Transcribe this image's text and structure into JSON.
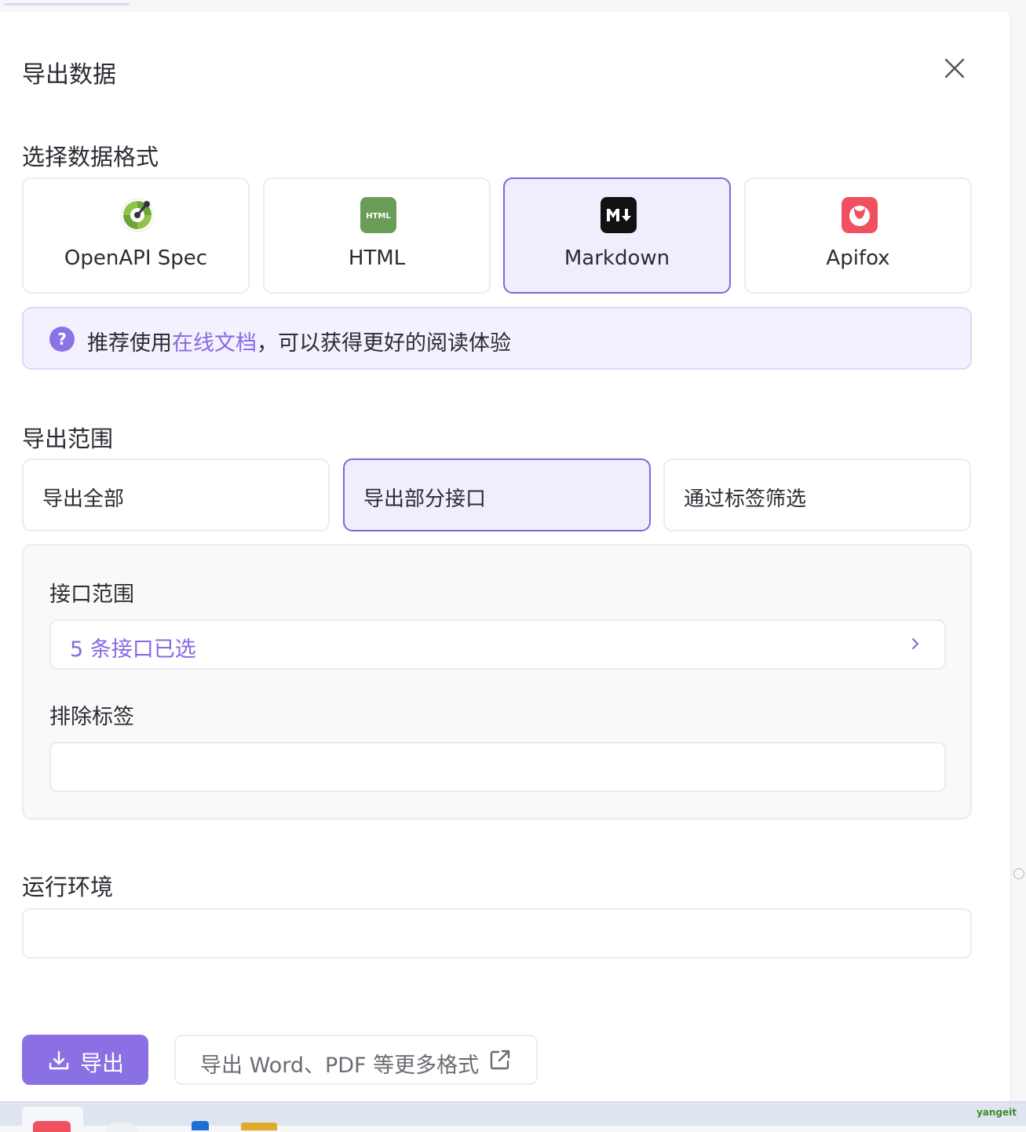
{
  "dialog": {
    "title": "导出数据"
  },
  "format_section": {
    "label": "选择数据格式",
    "options": [
      {
        "label": "OpenAPI Spec",
        "icon": "openapi-icon",
        "selected": false
      },
      {
        "label": "HTML",
        "icon": "html-icon",
        "selected": false
      },
      {
        "label": "Markdown",
        "icon": "markdown-icon",
        "selected": true
      },
      {
        "label": "Apifox",
        "icon": "apifox-icon",
        "selected": false
      }
    ]
  },
  "tip": {
    "prefix": "推荐使用",
    "link": "在线文档",
    "suffix": "，可以获得更好的阅读体验"
  },
  "range_section": {
    "label": "导出范围",
    "options": [
      {
        "label": "导出全部",
        "selected": false
      },
      {
        "label": "导出部分接口",
        "selected": true
      },
      {
        "label": "通过标签筛选",
        "selected": false
      }
    ],
    "interface_range_label": "接口范围",
    "interface_range_value": "5 条接口已选",
    "exclude_tags_label": "排除标签",
    "exclude_tags_value": ""
  },
  "env_section": {
    "label": "运行环境",
    "value": ""
  },
  "footer": {
    "export_label": "导出",
    "more_formats_label": "导出 Word、PDF 等更多格式"
  },
  "taskbar": {
    "brand": "yangeit"
  },
  "colors": {
    "accent": "#8b70e4",
    "selected_bg": "#f0eefc",
    "selected_border": "#7a6ad8",
    "link": "#8769e4",
    "tip_bg": "#f3f1fe"
  }
}
